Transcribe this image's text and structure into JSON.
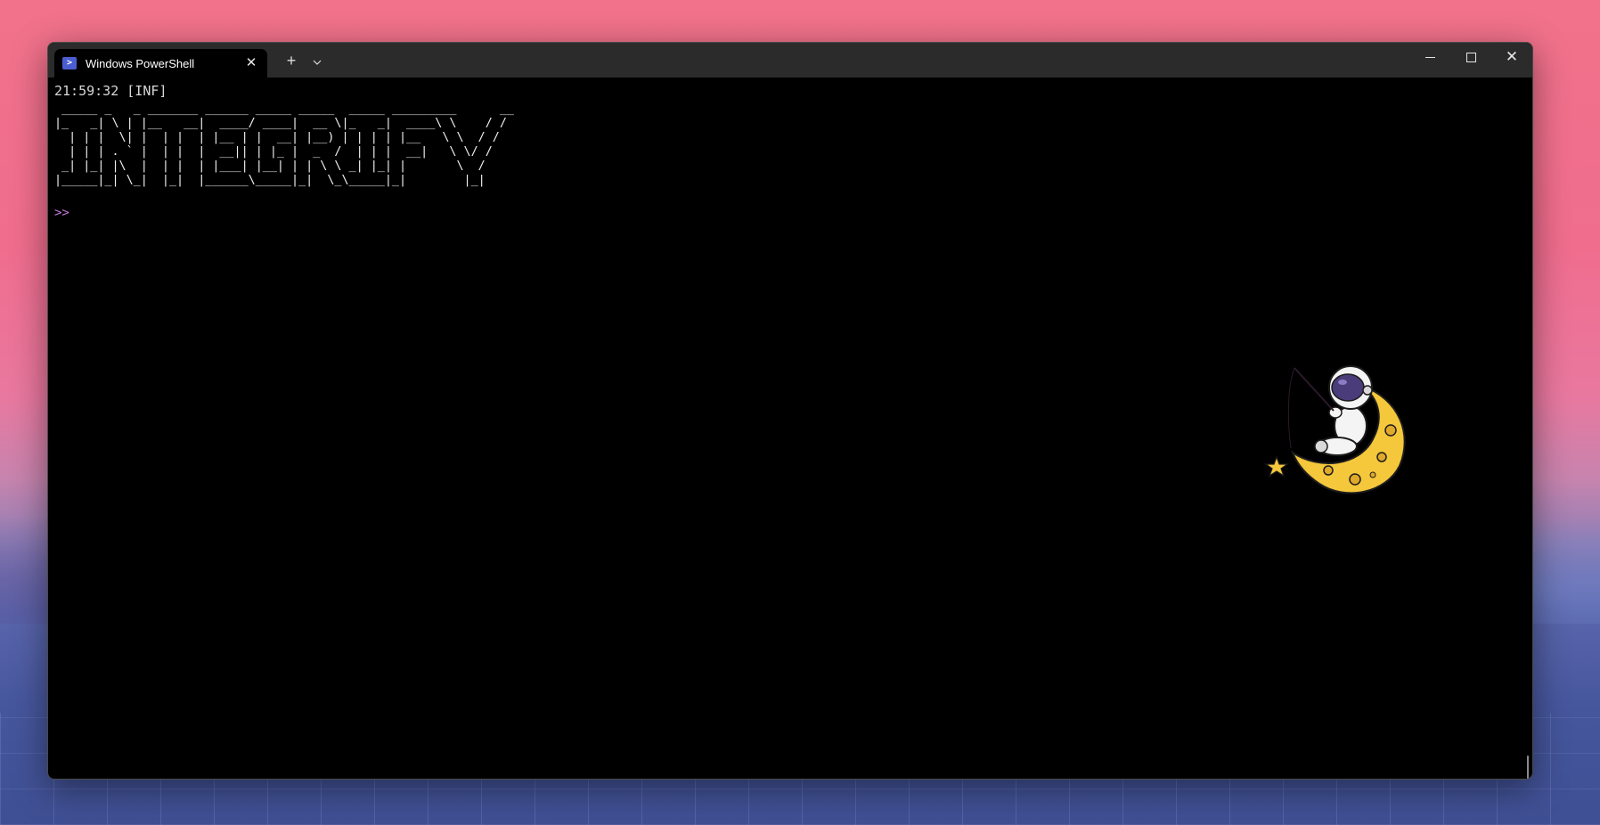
{
  "window": {
    "tab_title": "Windows PowerShell",
    "tab_icon": "powershell-icon",
    "tab_close_icon": "close-icon",
    "new_tab_icon": "plus-icon",
    "dropdown_icon": "chevron-down-icon",
    "minimize_icon": "minimize-icon",
    "maximize_icon": "maximize-icon",
    "close_icon": "close-icon"
  },
  "terminal": {
    "log_line": "21:59:32 [INF]",
    "ascii_banner": " _____ _   _ _______ ______ _____ _____  _____ _________      __\n|_   _| \\ | |__   __|  ____/ ____|  __ \\|_   _|  ____\\ \\    / /\n  | | |  \\| |  | |  | |__ | |  __| |__) | | | | |__   \\ \\  / /\n  | | | . ` |  | |  |  __|| | |_ |  _  /  | | |  __|   \\ \\/ /\n _| |_| |\\  |  | |  | |___| |__| | | \\ \\ _| |_| |       \\  /\n|_____|_| \\_|  |_|  |______\\_____|_|  \\_\\_____|_|        |_|",
    "prompt": ">>"
  },
  "colors": {
    "prompt": "#c678dd",
    "background": "#000000",
    "titlebar": "#2b2b2b"
  },
  "decoration": {
    "background_image": "astronaut-on-moon-fishing-star"
  }
}
